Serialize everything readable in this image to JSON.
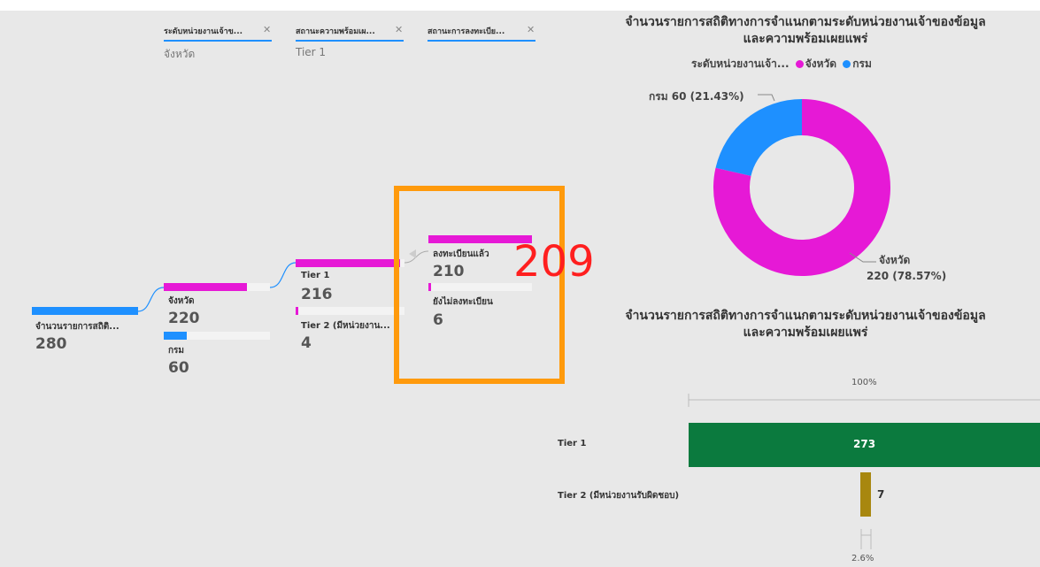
{
  "top_marks": {
    "left": "",
    "right": ""
  },
  "filters": [
    {
      "label": "ระดับหน่วยงานเจ้าข...",
      "value": "จังหวัด"
    },
    {
      "label": "สถานะความพร้อมเผ...",
      "value": "Tier 1"
    },
    {
      "label": "สถานะการลงทะเบีย...",
      "value": ""
    }
  ],
  "tree": {
    "root": {
      "label": "จำนวนรายการสถิติ...",
      "value": "280"
    },
    "level1": [
      {
        "label": "จังหวัด",
        "value": "220"
      },
      {
        "label": "กรม",
        "value": "60"
      }
    ],
    "level2": [
      {
        "label": "Tier 1",
        "value": "216"
      },
      {
        "label": "Tier 2 (มีหน่วยงาน...",
        "value": "4"
      }
    ],
    "level3": [
      {
        "label": "ลงทะเบียนแล้ว",
        "value": "210"
      },
      {
        "label": "ยังไม่ลงทะเบียน",
        "value": "6"
      }
    ]
  },
  "annotation": {
    "text": "209",
    "color": "#ff1f1f",
    "box_color": "#ff9a0c"
  },
  "colors": {
    "province": "#e619d6",
    "department": "#1e90ff",
    "tier1": "#0b7a3e",
    "tier2": "#a8870f"
  },
  "chart_data": [
    {
      "type": "pie",
      "title_line1": "จำนวนรายการสถิติทางการจำแนกตามระดับหน่วยงานเจ้าของข้อมูล",
      "title_line2": "และความพร้อมเผยแพร่",
      "legend_title": "ระดับหน่วยงานเจ้า...",
      "donut": true,
      "slices": [
        {
          "name": "จังหวัด",
          "value": 220,
          "label": "220 (78.57%)",
          "color": "#e619d6"
        },
        {
          "name": "กรม",
          "value": 60,
          "label": "กรม 60 (21.43%)",
          "color": "#1e90ff"
        }
      ]
    },
    {
      "type": "bar",
      "orientation": "horizontal",
      "title_line1": "จำนวนรายการสถิติทางการจำแนกตามระดับหน่วยงานเจ้าของข้อมูล",
      "title_line2": "และความพร้อมเผยแพร่",
      "categories": [
        "Tier 1",
        "Tier 2 (มีหน่วยงานรับผิดชอบ)"
      ],
      "values": [
        273,
        7
      ],
      "value_labels": [
        "273",
        "7"
      ],
      "percent_top": "100%",
      "percent_bottom": "2.6%"
    }
  ]
}
